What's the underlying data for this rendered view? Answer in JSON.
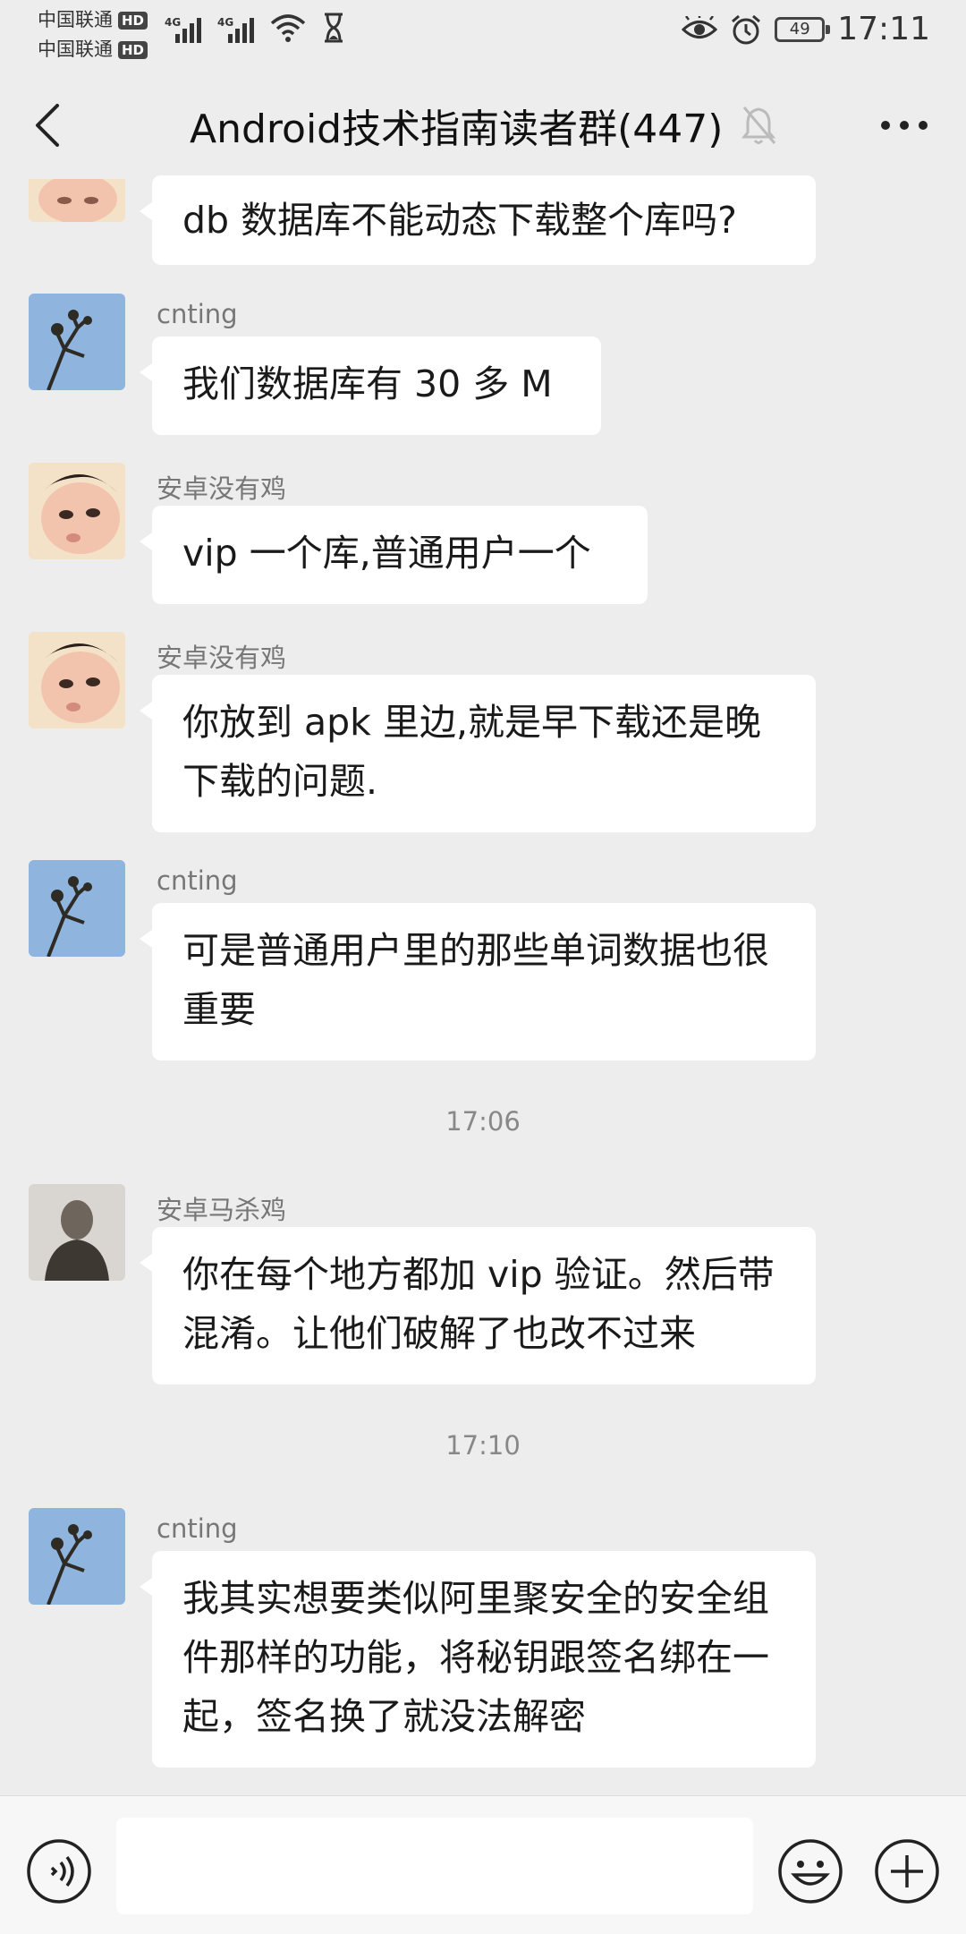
{
  "status_bar": {
    "carrier_1": "中国联通",
    "carrier_2": "中国联通",
    "hd_badge": "HD",
    "network": "4G",
    "battery": "49",
    "time": "17:11"
  },
  "header": {
    "title": "Android技术指南读者群(447)"
  },
  "messages": [
    {
      "sender": "",
      "text": "db 数据库不能动态下载整个库吗?",
      "avatar": "baby-avatar"
    },
    {
      "sender": "cnting",
      "text": "我们数据库有 30 多 M",
      "avatar": "tree-avatar"
    },
    {
      "sender": "安卓没有鸡",
      "text": "vip 一个库,普通用户一个",
      "avatar": "baby-avatar"
    },
    {
      "sender": "安卓没有鸡",
      "text": "你放到 apk 里边,就是早下载还是晚下载的问题.",
      "avatar": "baby-avatar"
    },
    {
      "sender": "cnting",
      "text": "可是普通用户里的那些单词数据也很重要",
      "avatar": "tree-avatar"
    },
    {
      "sender": "安卓马杀鸡",
      "text": "你在每个地方都加 vip 验证。然后带混淆。让他们破解了也改不过来",
      "avatar": "portrait-avatar"
    },
    {
      "sender": "cnting",
      "text": "我其实想要类似阿里聚安全的安全组件那样的功能，将秘钥跟签名绑在一起，签名换了就没法解密",
      "avatar": "tree-avatar"
    }
  ],
  "timestamps": [
    "17:06",
    "17:10"
  ],
  "icons": {
    "back": "back-arrow-icon",
    "mute": "mute-bell-icon",
    "more": "more-icon",
    "voice": "voice-icon",
    "emoji": "emoji-icon",
    "plus": "plus-icon"
  },
  "colors": {
    "background": "#ededed",
    "bubble": "#ffffff",
    "input_bar": "#f7f7f7"
  }
}
